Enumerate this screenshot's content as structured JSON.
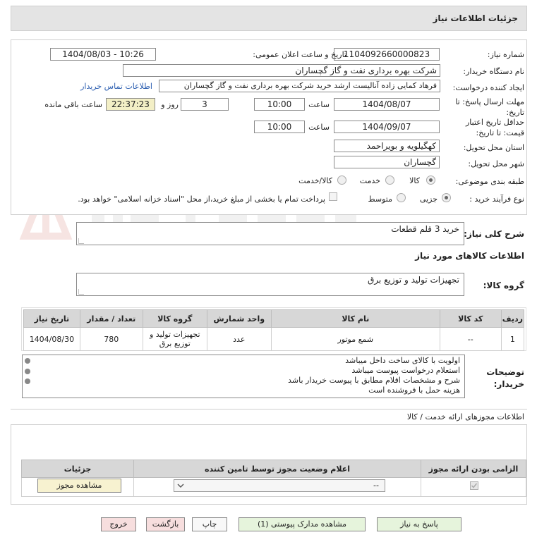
{
  "header": {
    "title": "جزئیات اطلاعات نیاز"
  },
  "form": {
    "need_number_label": "شماره نیاز:",
    "need_number": "1104092660000823",
    "announce_label": "تاریخ و ساعت اعلان عمومی:",
    "announce_value": "1404/08/03 - 10:26",
    "buyer_org_label": "نام دستگاه خریدار:",
    "buyer_org": "شرکت بهره برداری نفت و گاز گچساران",
    "creator_label": "ایجاد کننده درخواست:",
    "creator": "فرهاد کمایی زاده آنالیست ارشد خرید شرکت بهره برداری نفت و گاز گچساران",
    "contact_link": "اطلاعات تماس خریدار",
    "deadline_label": "مهلت ارسال پاسخ: تا تاریخ:",
    "deadline_date": "1404/08/07",
    "time_label": "ساعت",
    "deadline_time": "10:00",
    "days_value": "3",
    "days_label": "روز و",
    "remaining_time": "22:37:23",
    "remaining_label": "ساعت باقی مانده",
    "price_valid_label": "حداقل تاریخ اعتبار قیمت: تا تاریخ:",
    "price_valid_date": "1404/09/07",
    "price_valid_time": "10:00",
    "province_label": "استان محل تحویل:",
    "province": "کهگیلویه و بویراحمد",
    "city_label": "شهر محل تحویل:",
    "city": "گچساران",
    "category_label": "طبقه بندی موضوعی:",
    "category_options": [
      "کالا",
      "خدمت",
      "کالا/خدمت"
    ],
    "process_label": "نوع فرآیند خرید :",
    "process_options": [
      "جزیی",
      "متوسط"
    ],
    "payment_note": "پرداخت تمام یا بخشی از مبلغ خرید،از محل \"اسناد خزانه اسلامی\" خواهد بود."
  },
  "summary": {
    "label": "شرح کلی نیاز:",
    "value": "خرید 3 قلم قطعات",
    "goods_info_title": "اطلاعات کالاهای مورد نیاز",
    "group_label": "گروه کالا:",
    "group_value": "تجهیزات تولید و توزیع برق"
  },
  "items_table": {
    "headers": [
      "ردیف",
      "کد کالا",
      "نام کالا",
      "واحد شمارش",
      "گروه کالا",
      "تعداد / مقدار",
      "تاریخ نیاز"
    ],
    "rows": [
      [
        "1",
        "--",
        "شمع موتور",
        "عدد",
        "تجهیزات تولید و توزیع برق",
        "780",
        "1404/08/30"
      ]
    ]
  },
  "buyer_notes": {
    "label": "توضیحات خریدار:",
    "lines": [
      "اولویت با کالای ساخت داخل میباشد",
      "استعلام درخواست پیوست میباشد",
      "شرح و مشخصات اقلام مطابق با پیوست خریدار باشد",
      "هزینه حمل با فروشنده است"
    ]
  },
  "permits": {
    "title": "اطلاعات مجوزهای ارائه خدمت / کالا",
    "headers": [
      "الزامی بودن ارائه مجوز",
      "اعلام وضعیت مجوز توسط تامین کننده",
      "جزئیات"
    ],
    "select_value": "--",
    "view_button": "مشاهده مجوز"
  },
  "buttons": {
    "reply": "پاسخ به نیاز",
    "attachments": "مشاهده مدارک پیوستی (1)",
    "print": "چاپ",
    "back": "بازگشت",
    "exit": "خروج"
  },
  "icons": {
    "chevron": "chevron-down-icon",
    "check": "check-icon",
    "watermark": "ariatender-logo"
  }
}
